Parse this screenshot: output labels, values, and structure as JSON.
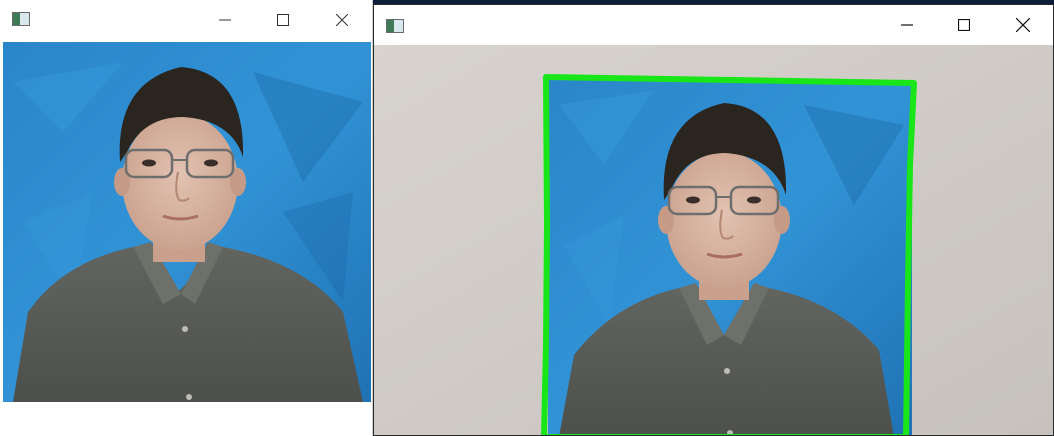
{
  "windows": [
    {
      "id": "cropped-output",
      "title": "",
      "controls": {
        "minimize": "minimize-icon",
        "maximize": "maximize-icon",
        "close": "close-icon"
      }
    },
    {
      "id": "camera-feed",
      "title": "",
      "controls": {
        "minimize": "minimize-icon",
        "maximize": "maximize-icon",
        "close": "close-icon"
      },
      "detection_box_color": "#19e619"
    }
  ],
  "colors": {
    "backdrop_blue": "#2a86c9",
    "wall": "#d7d2cd",
    "shirt": "#5b5d58",
    "skin": "#d7b6a4",
    "hair": "#2b2520",
    "detection_green": "#19e619"
  }
}
